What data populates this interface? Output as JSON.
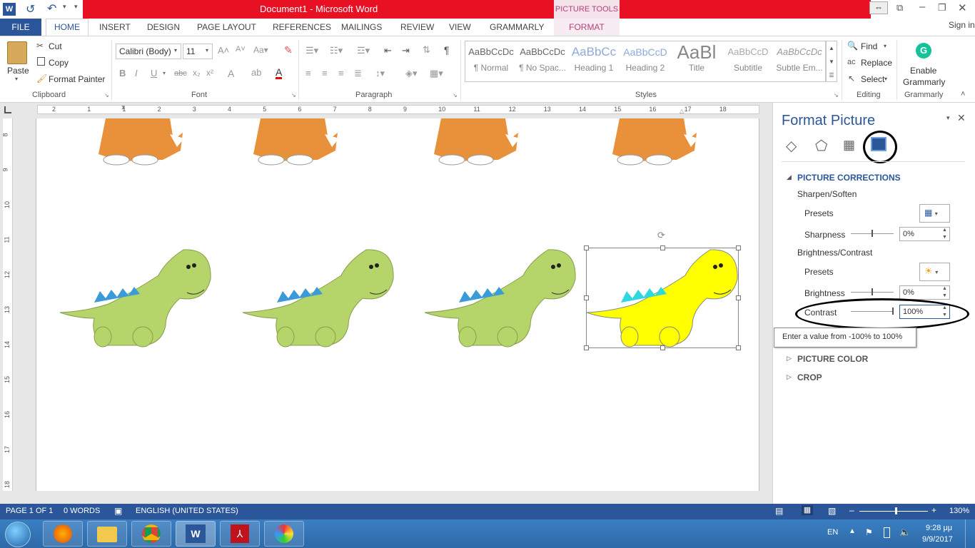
{
  "window": {
    "title": "Document1 -  Microsoft Word",
    "picture_tools_label": "PICTURE TOOLS",
    "sign_in": "Sign in"
  },
  "tabs": {
    "file": "FILE",
    "home": "HOME",
    "insert": "INSERT",
    "design": "DESIGN",
    "page_layout": "PAGE LAYOUT",
    "references": "REFERENCES",
    "mailings": "MAILINGS",
    "review": "REVIEW",
    "view": "VIEW",
    "grammarly": "GRAMMARLY",
    "format": "FORMAT"
  },
  "clipboard": {
    "paste": "Paste",
    "cut": "Cut",
    "copy": "Copy",
    "format_painter": "Format Painter",
    "group_label": "Clipboard"
  },
  "font": {
    "name": "Calibri (Body)",
    "size": "11",
    "group_label": "Font"
  },
  "paragraph": {
    "group_label": "Paragraph"
  },
  "styles": {
    "items": [
      {
        "preview": "AaBbCcDc",
        "name": "¶ Normal"
      },
      {
        "preview": "AaBbCcDc",
        "name": "¶ No Spac..."
      },
      {
        "preview": "AaBbCc",
        "name": "Heading 1"
      },
      {
        "preview": "AaBbCcD",
        "name": "Heading 2"
      },
      {
        "preview": "AaBl",
        "name": "Title"
      },
      {
        "preview": "AaBbCcD",
        "name": "Subtitle"
      },
      {
        "preview": "AaBbCcDc",
        "name": "Subtle Em..."
      }
    ],
    "group_label": "Styles"
  },
  "editing": {
    "find": "Find",
    "replace": "Replace",
    "select": "Select",
    "group_label": "Editing"
  },
  "grammarly": {
    "enable": "Enable",
    "name": "Grammarly",
    "group_label": "Grammarly"
  },
  "ruler": {
    "h_ticks": [
      "2",
      "1",
      "1",
      "2",
      "3",
      "4",
      "5",
      "6",
      "7",
      "8",
      "9",
      "10",
      "11",
      "12",
      "13",
      "14",
      "15",
      "16",
      "17",
      "18"
    ],
    "v_ticks": [
      "8",
      "9",
      "10",
      "11",
      "12",
      "13",
      "14",
      "15",
      "16",
      "17",
      "18"
    ]
  },
  "pane": {
    "title": "Format Picture",
    "section_corrections": "PICTURE CORRECTIONS",
    "sharpen_soften": "Sharpen/Soften",
    "presets1": "Presets",
    "sharpness": "Sharpness",
    "sharpness_value": "0%",
    "brightness_contrast": "Brightness/Contrast",
    "presets2": "Presets",
    "brightness": "Brightness",
    "brightness_value": "0%",
    "contrast": "Contrast",
    "contrast_value": "100%",
    "tooltip": "Enter a value from -100% to 100%",
    "section_color": "PICTURE COLOR",
    "section_crop": "CROP"
  },
  "status": {
    "page": "PAGE 1 OF 1",
    "words": "0 WORDS",
    "language": "ENGLISH (UNITED STATES)",
    "zoom": "130%"
  },
  "taskbar": {
    "lang": "EN",
    "time": "9:28 μμ",
    "date": "9/9/2017"
  },
  "colors": {
    "accent": "#2b579a",
    "title_red": "#e81123",
    "dino_green": "#b5d56a",
    "dino_yellow": "#ffff00",
    "spikes": "#3b9bd8"
  }
}
